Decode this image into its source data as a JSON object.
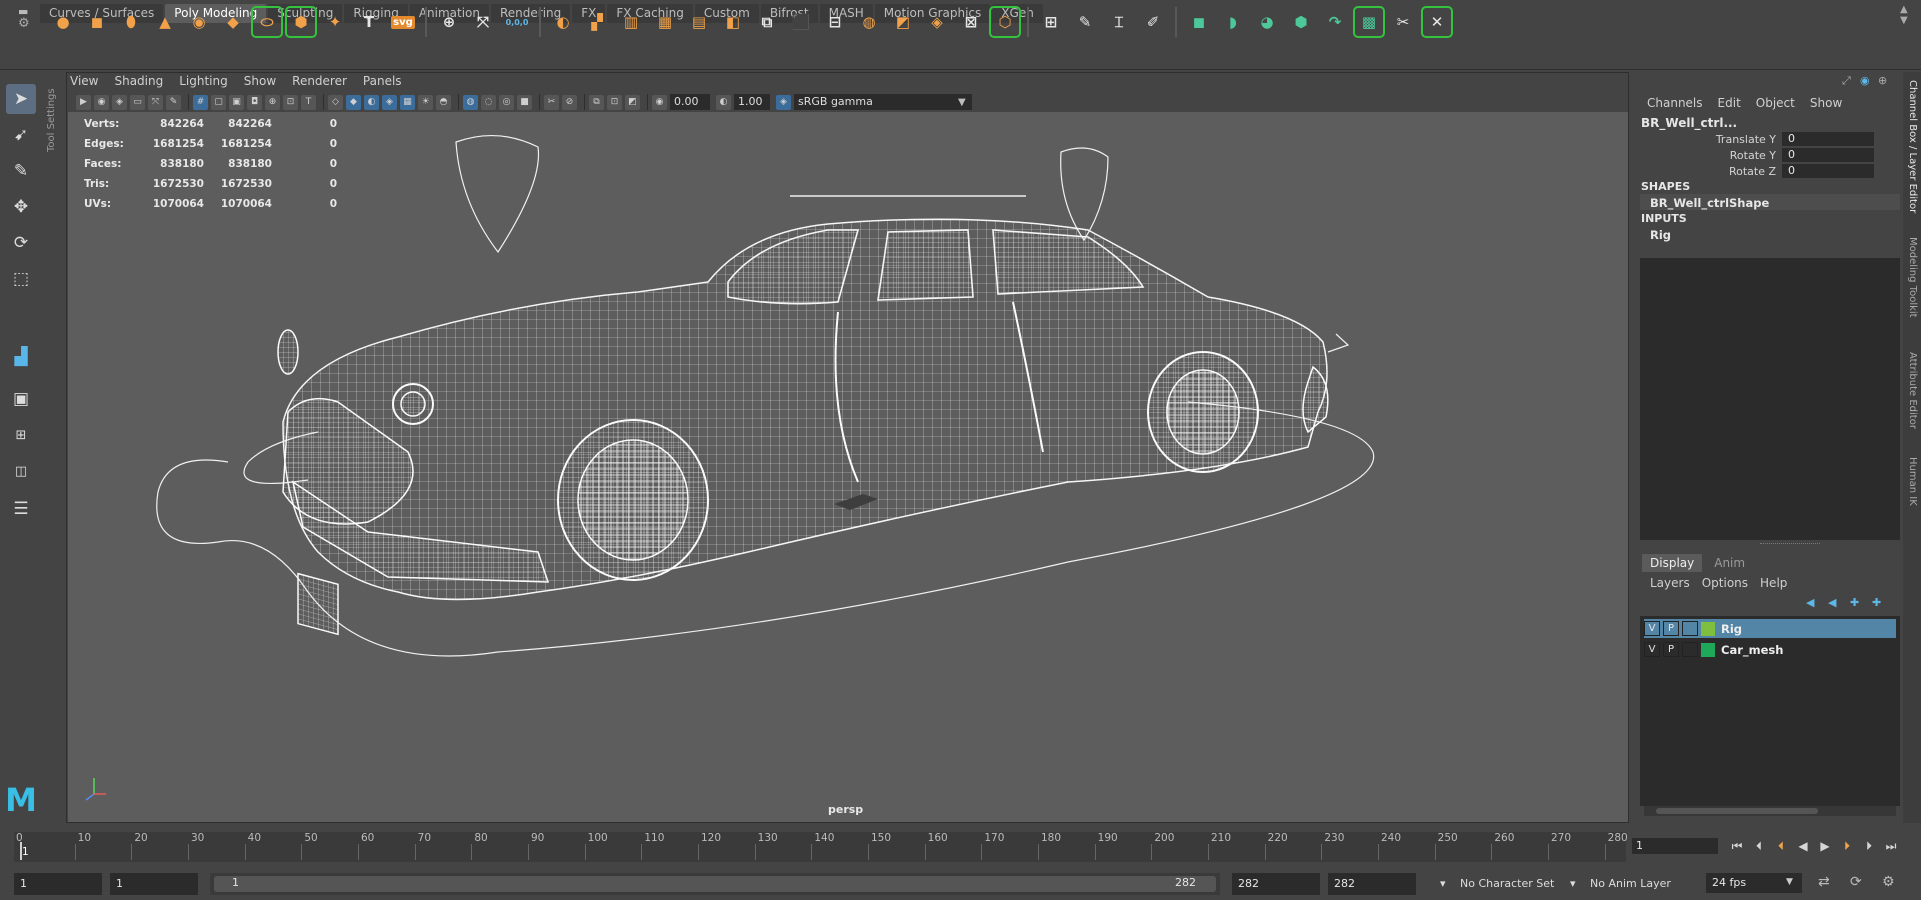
{
  "shelf_tabs": [
    "Curves / Surfaces",
    "Poly Modeling",
    "Sculpting",
    "Rigging",
    "Animation",
    "Rendering",
    "FX",
    "FX Caching",
    "Custom",
    "Bifrost",
    "MASH",
    "Motion Graphics",
    "XGen"
  ],
  "active_shelf_tab": "Poly Modeling",
  "shelf_icons": {
    "text_tool_glyph": "T",
    "svg_tool_glyph": "svg",
    "sculpt_value": "0,0,0"
  },
  "panel_menu": [
    "View",
    "Shading",
    "Lighting",
    "Show",
    "Renderer",
    "Panels"
  ],
  "panel_toolbar": {
    "exposure": "0.00",
    "gamma": "1.00",
    "color_space": "sRGB gamma"
  },
  "tool_settings_label": "Tool Settings",
  "hud": {
    "rows": [
      {
        "label": "Verts:",
        "a": "842264",
        "b": "842264",
        "c": "0"
      },
      {
        "label": "Edges:",
        "a": "1681254",
        "b": "1681254",
        "c": "0"
      },
      {
        "label": "Faces:",
        "a": "838180",
        "b": "838180",
        "c": "0"
      },
      {
        "label": "Tris:",
        "a": "1672530",
        "b": "1672530",
        "c": "0"
      },
      {
        "label": "UVs:",
        "a": "1070064",
        "b": "1070064",
        "c": "0"
      }
    ]
  },
  "camera_label": "persp",
  "right_vertical_tabs": [
    "Channel Box / Layer Editor",
    "Modeling Toolkit",
    "Attribute Editor",
    "Human IK"
  ],
  "channel_box": {
    "menu": [
      "Channels",
      "Edit",
      "Object",
      "Show"
    ],
    "object_name": "BR_Well_ctrl...",
    "attributes": [
      {
        "label": "Translate Y",
        "value": "0"
      },
      {
        "label": "Rotate Y",
        "value": "0"
      },
      {
        "label": "Rotate Z",
        "value": "0"
      }
    ],
    "shapes_header": "SHAPES",
    "shape_name": "BR_Well_ctrlShape",
    "inputs_header": "INPUTS",
    "input_name": "Rig"
  },
  "layer_editor": {
    "tabs": [
      "Display",
      "Anim"
    ],
    "active_tab": "Display",
    "menu": [
      "Layers",
      "Options",
      "Help"
    ],
    "layers": [
      {
        "v": "V",
        "p": "P",
        "name": "Rig",
        "color": "#7fbf3f",
        "selected": true
      },
      {
        "v": "V",
        "p": "P",
        "name": "Car_mesh",
        "color": "#1fa85a",
        "selected": false
      }
    ]
  },
  "time_slider": {
    "ticks": [
      "10",
      "20",
      "30",
      "40",
      "50",
      "60",
      "70",
      "80",
      "90",
      "100",
      "110",
      "120",
      "130",
      "140",
      "150",
      "160",
      "170",
      "180",
      "190",
      "200",
      "210",
      "220",
      "230",
      "240",
      "250",
      "260",
      "270",
      "280"
    ],
    "start_label": "0",
    "current_frame_marker": "1",
    "current_frame": "1"
  },
  "range_bar": {
    "start_time": "1",
    "playback_start": "1",
    "slider_start": "1",
    "slider_end": "282",
    "playback_end": "282",
    "end_time": "282",
    "character_set": "No Character Set",
    "anim_layer": "No Anim Layer",
    "fps": "24 fps"
  },
  "colors": {
    "accent_blue": "#5285a6",
    "shelf_orange": "#f0a14a",
    "shelf_green": "#4cc89a",
    "maya_logo": "#39bfe6"
  }
}
